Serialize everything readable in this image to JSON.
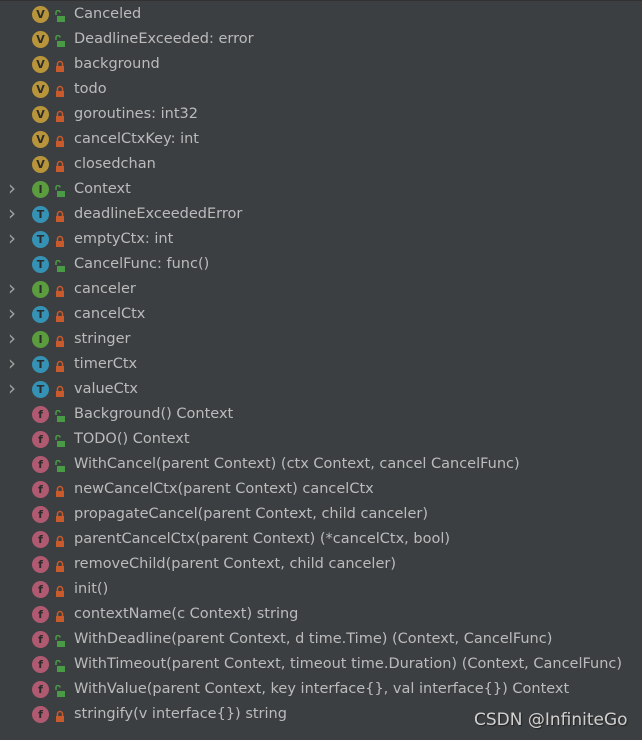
{
  "colors": {
    "background": "#3c3f41",
    "text": "#bbbbbb",
    "variable": "#b8953a",
    "type": "#3592b5",
    "interface": "#5b9c3f",
    "function": "#b05a72",
    "public_lock": "#4a9b45",
    "private_lock": "#c95a2c"
  },
  "items": [
    {
      "label": "Canceled",
      "kind": "V",
      "public": true,
      "expandable": false
    },
    {
      "label": "DeadlineExceeded: error",
      "kind": "V",
      "public": true,
      "expandable": false
    },
    {
      "label": "background",
      "kind": "V",
      "public": false,
      "expandable": false
    },
    {
      "label": "todo",
      "kind": "V",
      "public": false,
      "expandable": false
    },
    {
      "label": "goroutines: int32",
      "kind": "V",
      "public": false,
      "expandable": false
    },
    {
      "label": "cancelCtxKey: int",
      "kind": "V",
      "public": false,
      "expandable": false
    },
    {
      "label": "closedchan",
      "kind": "V",
      "public": false,
      "expandable": false
    },
    {
      "label": "Context",
      "kind": "I",
      "public": true,
      "expandable": true
    },
    {
      "label": "deadlineExceededError",
      "kind": "T",
      "public": false,
      "expandable": true
    },
    {
      "label": "emptyCtx: int",
      "kind": "T",
      "public": false,
      "expandable": true
    },
    {
      "label": "CancelFunc: func()",
      "kind": "T",
      "public": true,
      "expandable": false
    },
    {
      "label": "canceler",
      "kind": "I",
      "public": false,
      "expandable": true
    },
    {
      "label": "cancelCtx",
      "kind": "T",
      "public": false,
      "expandable": true
    },
    {
      "label": "stringer",
      "kind": "I",
      "public": false,
      "expandable": true
    },
    {
      "label": "timerCtx",
      "kind": "T",
      "public": false,
      "expandable": true
    },
    {
      "label": "valueCtx",
      "kind": "T",
      "public": false,
      "expandable": true
    },
    {
      "label": "Background() Context",
      "kind": "f",
      "public": true,
      "expandable": false
    },
    {
      "label": "TODO() Context",
      "kind": "f",
      "public": true,
      "expandable": false
    },
    {
      "label": "WithCancel(parent Context) (ctx Context, cancel CancelFunc)",
      "kind": "f",
      "public": true,
      "expandable": false
    },
    {
      "label": "newCancelCtx(parent Context) cancelCtx",
      "kind": "f",
      "public": false,
      "expandable": false
    },
    {
      "label": "propagateCancel(parent Context, child canceler)",
      "kind": "f",
      "public": false,
      "expandable": false
    },
    {
      "label": "parentCancelCtx(parent Context) (*cancelCtx, bool)",
      "kind": "f",
      "public": false,
      "expandable": false
    },
    {
      "label": "removeChild(parent Context, child canceler)",
      "kind": "f",
      "public": false,
      "expandable": false
    },
    {
      "label": "init()",
      "kind": "f",
      "public": false,
      "expandable": false
    },
    {
      "label": "contextName(c Context) string",
      "kind": "f",
      "public": false,
      "expandable": false
    },
    {
      "label": "WithDeadline(parent Context, d time.Time) (Context, CancelFunc)",
      "kind": "f",
      "public": true,
      "expandable": false
    },
    {
      "label": "WithTimeout(parent Context, timeout time.Duration) (Context, CancelFunc)",
      "kind": "f",
      "public": true,
      "expandable": false
    },
    {
      "label": "WithValue(parent Context, key interface{}, val interface{}) Context",
      "kind": "f",
      "public": true,
      "expandable": false
    },
    {
      "label": "stringify(v interface{}) string",
      "kind": "f",
      "public": false,
      "expandable": false
    }
  ],
  "watermark": "CSDN @InfiniteGo"
}
